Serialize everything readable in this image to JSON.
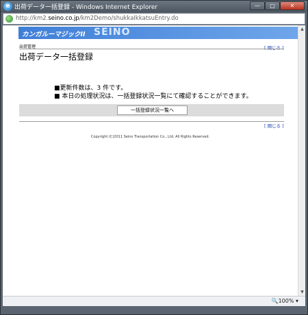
{
  "window": {
    "title": "出荷データ一括登録 - Windows Internet Explorer",
    "min_glyph": "—",
    "max_glyph": "□",
    "close_glyph": "✕"
  },
  "address": {
    "prefix": "http://km2.",
    "host": "seino.co.jp",
    "path": "/km2Demo/shukkaIkkatsuEntry.do"
  },
  "banner": {
    "app_name": "カンガルーマジックII",
    "brand": "SEINO"
  },
  "page": {
    "section_label": "出荷管理",
    "close_label": "[ 閉じる ]",
    "title": "出荷データ一括登録",
    "message_1": "■更新件数は、3 件です。",
    "message_2": "■ 本日の処理状況は、一括登録状況一覧にて確認することができます。",
    "action_button": "一括登録状況一覧へ",
    "close_label_bottom": "[ 閉じる ]",
    "copyright": "Copyright (C)2011 Seino Transportation Co., Ltd. All Rights Reserved."
  },
  "status": {
    "zoom": "🔍100%  ▾"
  },
  "colors": {
    "banner_start": "#3f7fd8",
    "banner_end": "#6fa6ea",
    "link": "#1a3fb0"
  },
  "icons": [
    "ie-icon",
    "page-icon",
    "scroll-up-icon",
    "scroll-down-icon",
    "zoom-icon"
  ]
}
